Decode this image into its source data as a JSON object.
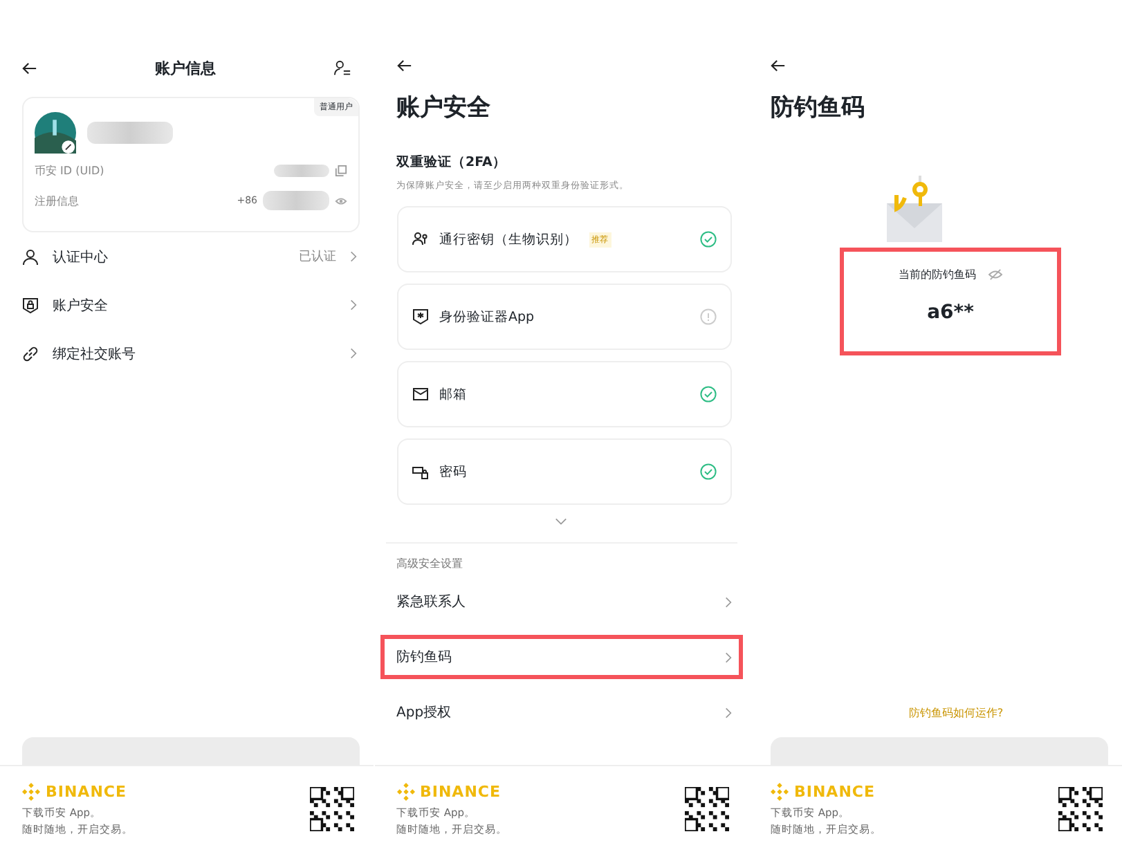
{
  "account_info": {
    "title": "账户信息",
    "badge": "普通用户",
    "uid_label": "币安 ID (UID)",
    "reg_label": "注册信息",
    "phone_prefix": "+86",
    "rows": [
      {
        "kind": "verify",
        "label": "认证中心",
        "value": "已认证"
      },
      {
        "kind": "shield",
        "label": "账户安全"
      },
      {
        "kind": "link",
        "label": "绑定社交账号"
      }
    ]
  },
  "account_security": {
    "title": "账户安全",
    "section": "双重验证（2FA）",
    "hint": "为保障账户安全，请至少启用两种双重身份验证形式。",
    "methods": [
      {
        "kind": "passkey",
        "label": "通行密钥（生物识别）",
        "tag": "推荐",
        "enabled": true
      },
      {
        "kind": "authenticator",
        "label": "身份验证器App",
        "enabled": false
      },
      {
        "kind": "email",
        "label": "邮箱",
        "enabled": true
      },
      {
        "kind": "password",
        "label": "密码",
        "enabled": true
      }
    ],
    "advanced_title": "高级安全设置",
    "advanced": [
      {
        "label": "紧急联系人",
        "highlighted": false
      },
      {
        "label": "防钓鱼码",
        "highlighted": true
      },
      {
        "label": "App授权",
        "highlighted": false
      }
    ]
  },
  "anti_phishing": {
    "title": "防钓鱼码",
    "code_label": "当前的防钓鱼码",
    "code": "a6**",
    "help_link": "防钓鱼码如何运作?"
  },
  "footers": [
    {
      "brand": "BINANCE",
      "line1": "下载币安 App。",
      "line2": "随时随地，开启交易。"
    },
    {
      "brand": "BINANCE",
      "line1": "下载币安 App。",
      "line2": "随时随地，开启交易。"
    },
    {
      "brand": "BINANCE",
      "line1": "下载币安 App。",
      "line2": "随时随地，开启交易。"
    }
  ]
}
